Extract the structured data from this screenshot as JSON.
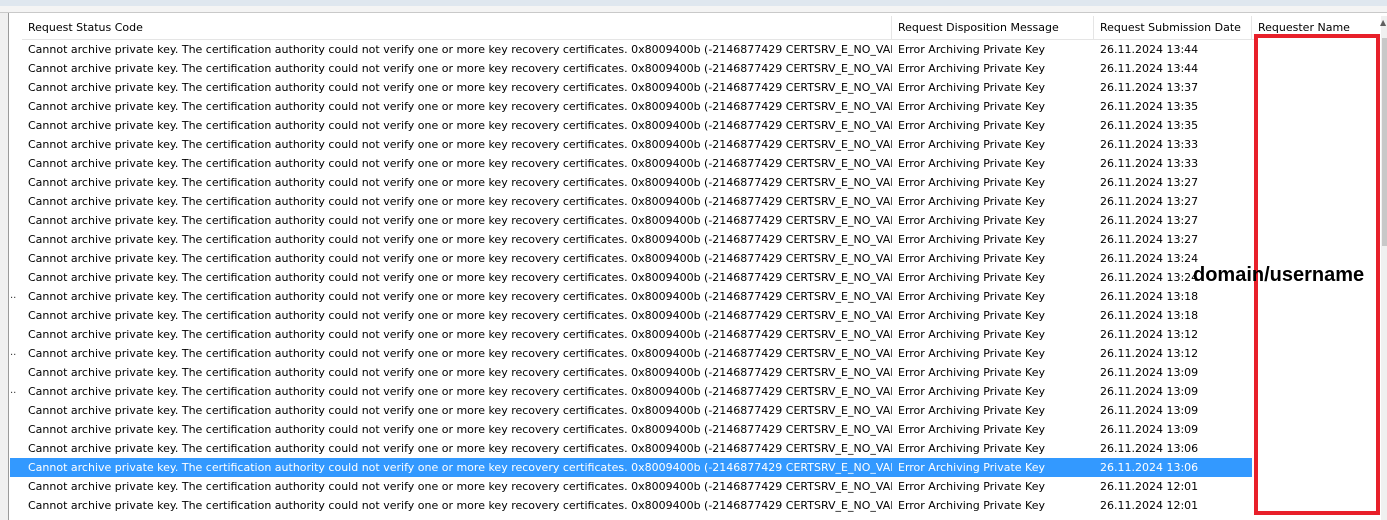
{
  "columns": [
    {
      "label": "Request Status Code"
    },
    {
      "label": "Request Disposition Message"
    },
    {
      "label": "Request Submission Date"
    },
    {
      "label": "Requester Name"
    }
  ],
  "rows": [
    {
      "status": "Cannot archive private key. The certification authority could not verify one or more key recovery certificates. 0x8009400b (-2146877429 CERTSRV_E_NO_VALID_KRA)",
      "disposition": "Error Archiving Private Key",
      "date": "26.11.2024 13:44"
    },
    {
      "status": "Cannot archive private key. The certification authority could not verify one or more key recovery certificates. 0x8009400b (-2146877429 CERTSRV_E_NO_VALID_KRA)",
      "disposition": "Error Archiving Private Key",
      "date": "26.11.2024 13:44"
    },
    {
      "status": "Cannot archive private key. The certification authority could not verify one or more key recovery certificates. 0x8009400b (-2146877429 CERTSRV_E_NO_VALID_KRA)",
      "disposition": "Error Archiving Private Key",
      "date": "26.11.2024 13:37"
    },
    {
      "status": "Cannot archive private key. The certification authority could not verify one or more key recovery certificates. 0x8009400b (-2146877429 CERTSRV_E_NO_VALID_KRA)",
      "disposition": "Error Archiving Private Key",
      "date": "26.11.2024 13:35"
    },
    {
      "status": "Cannot archive private key. The certification authority could not verify one or more key recovery certificates. 0x8009400b (-2146877429 CERTSRV_E_NO_VALID_KRA)",
      "disposition": "Error Archiving Private Key",
      "date": "26.11.2024 13:35"
    },
    {
      "status": "Cannot archive private key. The certification authority could not verify one or more key recovery certificates. 0x8009400b (-2146877429 CERTSRV_E_NO_VALID_KRA)",
      "disposition": "Error Archiving Private Key",
      "date": "26.11.2024 13:33"
    },
    {
      "status": "Cannot archive private key. The certification authority could not verify one or more key recovery certificates. 0x8009400b (-2146877429 CERTSRV_E_NO_VALID_KRA)",
      "disposition": "Error Archiving Private Key",
      "date": "26.11.2024 13:33"
    },
    {
      "status": "Cannot archive private key. The certification authority could not verify one or more key recovery certificates. 0x8009400b (-2146877429 CERTSRV_E_NO_VALID_KRA)",
      "disposition": "Error Archiving Private Key",
      "date": "26.11.2024 13:27"
    },
    {
      "status": "Cannot archive private key. The certification authority could not verify one or more key recovery certificates. 0x8009400b (-2146877429 CERTSRV_E_NO_VALID_KRA)",
      "disposition": "Error Archiving Private Key",
      "date": "26.11.2024 13:27"
    },
    {
      "status": "Cannot archive private key. The certification authority could not verify one or more key recovery certificates. 0x8009400b (-2146877429 CERTSRV_E_NO_VALID_KRA)",
      "disposition": "Error Archiving Private Key",
      "date": "26.11.2024 13:27"
    },
    {
      "status": "Cannot archive private key. The certification authority could not verify one or more key recovery certificates. 0x8009400b (-2146877429 CERTSRV_E_NO_VALID_KRA)",
      "disposition": "Error Archiving Private Key",
      "date": "26.11.2024 13:27"
    },
    {
      "status": "Cannot archive private key. The certification authority could not verify one or more key recovery certificates. 0x8009400b (-2146877429 CERTSRV_E_NO_VALID_KRA)",
      "disposition": "Error Archiving Private Key",
      "date": "26.11.2024 13:24"
    },
    {
      "status": "Cannot archive private key. The certification authority could not verify one or more key recovery certificates. 0x8009400b (-2146877429 CERTSRV_E_NO_VALID_KRA)",
      "disposition": "Error Archiving Private Key",
      "date": "26.11.2024 13:24"
    },
    {
      "status": "Cannot archive private key. The certification authority could not verify one or more key recovery certificates. 0x8009400b (-2146877429 CERTSRV_E_NO_VALID_KRA)",
      "disposition": "Error Archiving Private Key",
      "date": "26.11.2024 13:18"
    },
    {
      "status": "Cannot archive private key. The certification authority could not verify one or more key recovery certificates. 0x8009400b (-2146877429 CERTSRV_E_NO_VALID_KRA)",
      "disposition": "Error Archiving Private Key",
      "date": "26.11.2024 13:18"
    },
    {
      "status": "Cannot archive private key. The certification authority could not verify one or more key recovery certificates. 0x8009400b (-2146877429 CERTSRV_E_NO_VALID_KRA)",
      "disposition": "Error Archiving Private Key",
      "date": "26.11.2024 13:12"
    },
    {
      "status": "Cannot archive private key. The certification authority could not verify one or more key recovery certificates. 0x8009400b (-2146877429 CERTSRV_E_NO_VALID_KRA)",
      "disposition": "Error Archiving Private Key",
      "date": "26.11.2024 13:12"
    },
    {
      "status": "Cannot archive private key. The certification authority could not verify one or more key recovery certificates. 0x8009400b (-2146877429 CERTSRV_E_NO_VALID_KRA)",
      "disposition": "Error Archiving Private Key",
      "date": "26.11.2024 13:09"
    },
    {
      "status": "Cannot archive private key. The certification authority could not verify one or more key recovery certificates. 0x8009400b (-2146877429 CERTSRV_E_NO_VALID_KRA)",
      "disposition": "Error Archiving Private Key",
      "date": "26.11.2024 13:09"
    },
    {
      "status": "Cannot archive private key. The certification authority could not verify one or more key recovery certificates. 0x8009400b (-2146877429 CERTSRV_E_NO_VALID_KRA)",
      "disposition": "Error Archiving Private Key",
      "date": "26.11.2024 13:09"
    },
    {
      "status": "Cannot archive private key. The certification authority could not verify one or more key recovery certificates. 0x8009400b (-2146877429 CERTSRV_E_NO_VALID_KRA)",
      "disposition": "Error Archiving Private Key",
      "date": "26.11.2024 13:09"
    },
    {
      "status": "Cannot archive private key. The certification authority could not verify one or more key recovery certificates. 0x8009400b (-2146877429 CERTSRV_E_NO_VALID_KRA)",
      "disposition": "Error Archiving Private Key",
      "date": "26.11.2024 13:06"
    },
    {
      "status": "Cannot archive private key. The certification authority could not verify one or more key recovery certificates. 0x8009400b (-2146877429 CERTSRV_E_NO_VALID_KRA)",
      "disposition": "Error Archiving Private Key",
      "date": "26.11.2024 13:06",
      "selected": true
    },
    {
      "status": "Cannot archive private key. The certification authority could not verify one or more key recovery certificates. 0x8009400b (-2146877429 CERTSRV_E_NO_VALID_KRA)",
      "disposition": "Error Archiving Private Key",
      "date": "26.11.2024 12:01"
    },
    {
      "status": "Cannot archive private key. The certification authority could not verify one or more key recovery certificates. 0x8009400b (-2146877429 CERTSRV_E_NO_VALID_KRA)",
      "disposition": "Error Archiving Private Key",
      "date": "26.11.2024 12:01"
    }
  ],
  "left_column_ellipsis": "..",
  "annotation": {
    "text": "domain/username",
    "box_color": "#e8202a"
  },
  "colors": {
    "selection": "#3399ff",
    "selection_text": "#ffffff"
  }
}
